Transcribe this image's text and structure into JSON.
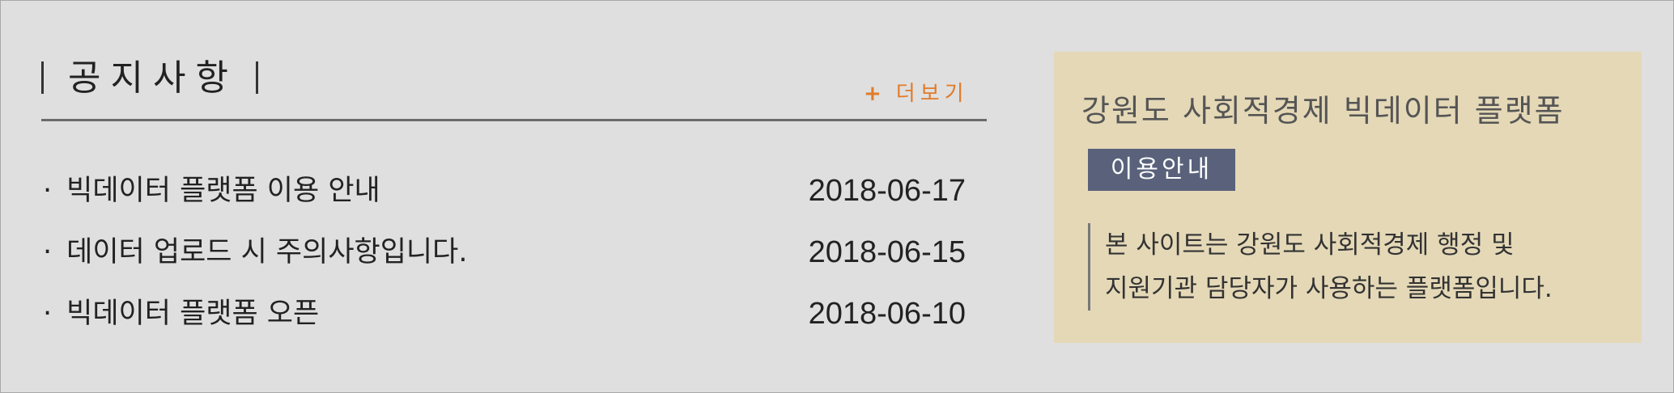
{
  "notice": {
    "title": "공지사항",
    "more_label": "더보기",
    "more_symbol": "+",
    "bullet": "·",
    "items": [
      {
        "subject": "빅데이터 플랫폼 이용 안내",
        "date": "2018-06-17"
      },
      {
        "subject": "데이터 업로드 시 주의사항입니다.",
        "date": "2018-06-15"
      },
      {
        "subject": "빅데이터 플랫폼 오픈",
        "date": "2018-06-10"
      }
    ]
  },
  "info": {
    "title": "강원도 사회적경제 빅데이터 플랫폼",
    "badge": "이용안내",
    "desc_line1": "본 사이트는 강원도 사회적경제 행정 및",
    "desc_line2": "지원기관 담당자가 사용하는 플랫폼입니다."
  },
  "colors": {
    "background": "#dfdfdf",
    "accent": "#e07b2a",
    "info_panel": "#e4d8b7",
    "badge": "#59627a"
  }
}
